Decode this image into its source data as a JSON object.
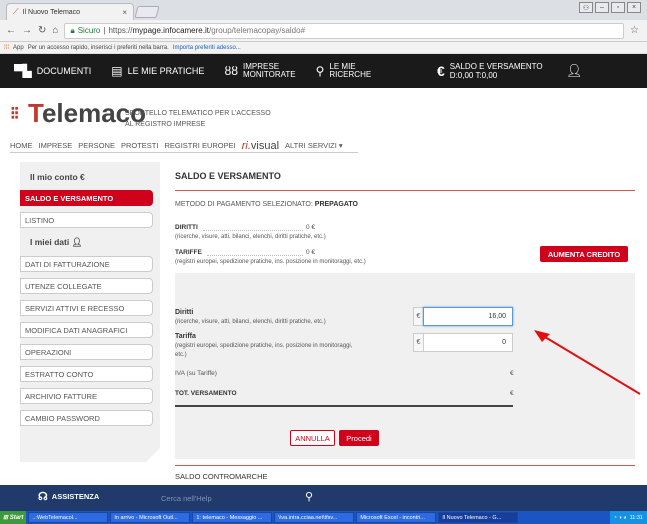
{
  "browser": {
    "tab_title": "Il Nuovo Telemaco",
    "secure_label": "Sicuro",
    "url_scheme": "https://",
    "url_host": "mypage.infocamere.it",
    "url_path": "/group/telemacopay/saldo#",
    "bookmarks_apps": "App",
    "bookmarks_hint": "Per un accesso rapido, inserisci i preferiti nella barra.",
    "bookmarks_import": "Importa preferiti adesso..."
  },
  "topnav": {
    "documenti": "DOCUMENTI",
    "pratiche": "LE MIE PRATICHE",
    "imprese_1": "IMPRESE",
    "imprese_2": "MONITORATE",
    "ricerche_1": "LE MIE",
    "ricerche_2": "RICERCHE",
    "saldo_1": "SALDO E VERSAMENTO",
    "saldo_2": "D:0,00 T:0,00"
  },
  "header": {
    "logo_text": "elemaco",
    "logo_initial": "T",
    "tagline_1": "SPORTELLO TELEMATICO PER L'ACCESSO",
    "tagline_2": "AL REGISTRO IMPRESE"
  },
  "menu": {
    "home": "HOME",
    "imprese": "IMPRESE",
    "persone": "PERSONE",
    "protesti": "PROTESTI",
    "registri": "REGISTRI EUROPEI",
    "rivisual_ri": "ri.",
    "rivisual_v": "visual",
    "altri": "ALTRI SERVIZI ▾"
  },
  "sidebar": {
    "conto_title": "Il mio conto €",
    "saldo": "SALDO E VERSAMENTO",
    "listino": "LISTINO",
    "dati_title": "I miei dati",
    "fatturazione": "DATI DI FATTURAZIONE",
    "utenze": "UTENZE COLLEGATE",
    "servizi": "SERVIZI ATTIVI E RECESSO",
    "modifica": "MODIFICA DATI ANAGRAFICI",
    "operazioni": "OPERAZIONI",
    "estratto": "ESTRATTO CONTO",
    "archivio": "ARCHIVIO FATTURE",
    "password": "CAMBIO PASSWORD"
  },
  "main": {
    "title": "SALDO E VERSAMENTO",
    "method_label": "METODO DI PAGAMENTO SELEZIONATO:",
    "method_value": "PREPAGATO",
    "diritti_label": "DIRITTI",
    "diritti_value": "0 €",
    "diritti_note": "(ricerche, visure, atti, bilanci, elenchi, diritti pratiche, etc.)",
    "tariffe_label": "TARIFFE",
    "tariffe_value": "0 €",
    "tariffe_note": "(registri europei, spedizione pratiche, ins. posizione in monitoraggi, etc.)",
    "aumenta_button": "AUMENTA CREDITO",
    "f_diritti_label": "Diritti",
    "f_diritti_note": "(ricerche, visure, atti, bilanci, elenchi, diritti pratiche, etc.)",
    "f_diritti_value": "16,00",
    "f_tariffa_label": "Tariffa",
    "f_tariffa_note_1": "(registri europei, spedizione pratiche, ins. posizione in monitoraggi,",
    "f_tariffa_note_2": "etc.)",
    "f_tariffa_value": "0",
    "currency": "€",
    "iva_label": "IVA (su Tariffe)",
    "iva_value": "€",
    "tot_label": "TOT. VERSAMENTO",
    "tot_value": "€",
    "annulla_button": "ANNULLA",
    "procedi_button": "Procedi",
    "contromarche": "SALDO CONTROMARCHE"
  },
  "footer": {
    "assistenza": "ASSISTENZA",
    "help_placeholder": "Cerca nell'Help"
  },
  "taskbar": {
    "start": "Start",
    "t1": "..:WebTelemacol...",
    "t2": "In arrivo - Microsoft Outl...",
    "t3": "1: telemaco - Messaggio ...",
    "t4": "\\\\va.intra.cciaa.net\\tfsv...",
    "t5": "Microsoft Excel - incontri...",
    "t6": "Il Nuovo Telemaco - G...",
    "clock": "11:31"
  },
  "colors": {
    "accent_red": "#d0021b",
    "nav_dark": "#1a1a1a",
    "footer_blue": "#1f3a6b",
    "taskbar_blue": "#1b55c4"
  }
}
